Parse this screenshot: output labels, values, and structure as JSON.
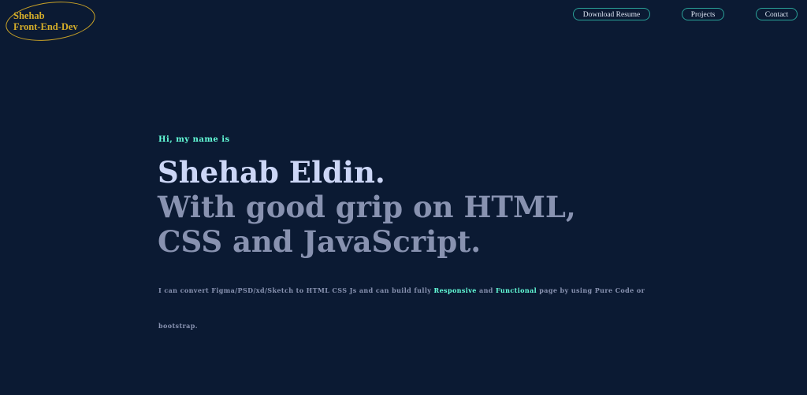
{
  "logo": {
    "line1": "Shehab",
    "line2": "Front-End-Dev"
  },
  "nav": {
    "download_resume": "Download Resume",
    "projects": "Projects",
    "contact": "Contact"
  },
  "hero": {
    "greeting": "Hi, my name is",
    "name": "Shehab Eldin.",
    "tagline_line1": "With good grip on HTML,",
    "tagline_line2": "CSS and JavaScript.",
    "description_part1": "I can convert Figma/PSD/xd/Sketch to HTML CSS Js and can build fully ",
    "highlight1": "Responsive",
    "description_part2": " and ",
    "highlight2": "Functional",
    "description_part3": " page by using Pure Code or bootstrap."
  },
  "colors": {
    "background": "#0b1a33",
    "accent": "#64ffda",
    "heading": "#ccd6f6",
    "muted": "#8892b0",
    "logo": "#d4ad2a",
    "button_border": "#2aa198"
  }
}
